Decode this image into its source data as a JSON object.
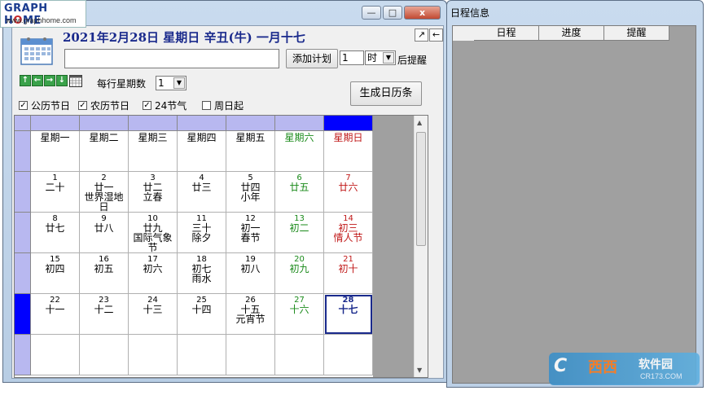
{
  "logo": {
    "brand_a": "GRAPH H",
    "brand_b": "O",
    "brand_c": "ME",
    "url": "www.graphhome.com"
  },
  "window_controls": {
    "minimize": "—",
    "maximize": "□",
    "close": "x"
  },
  "header": {
    "date_line": "2021年2月28日  星期日   辛丑(牛)  一月十七",
    "add_plan_label": "添加计划",
    "quantity_value": "1",
    "unit_value": "时",
    "remind_after": "后提醒",
    "weeks_per_label": "每行星期数",
    "weeks_value": "1",
    "generate_label": "生成日历条",
    "expand_icon": "↗",
    "collapse_icon": "←"
  },
  "nav_icons": [
    "↑",
    "←",
    "→",
    "↓"
  ],
  "checkboxes": [
    {
      "label": "公历节日",
      "checked": true
    },
    {
      "label": "农历节日",
      "checked": true
    },
    {
      "label": "24节气",
      "checked": true
    },
    {
      "label": "周日起",
      "checked": false
    }
  ],
  "calendar": {
    "weekday_headers": [
      "星期一",
      "星期二",
      "星期三",
      "星期四",
      "星期五",
      "星期六",
      "星期日"
    ],
    "weeks": [
      [
        {
          "day": "1",
          "lunar": "二十",
          "festival": ""
        },
        {
          "day": "2",
          "lunar": "廿一",
          "festival": "世界湿地日"
        },
        {
          "day": "3",
          "lunar": "廿二",
          "festival": "立春"
        },
        {
          "day": "4",
          "lunar": "廿三",
          "festival": ""
        },
        {
          "day": "5",
          "lunar": "廿四",
          "festival": "小年"
        },
        {
          "day": "6",
          "lunar": "廿五",
          "festival": ""
        },
        {
          "day": "7",
          "lunar": "廿六",
          "festival": ""
        }
      ],
      [
        {
          "day": "8",
          "lunar": "廿七",
          "festival": ""
        },
        {
          "day": "9",
          "lunar": "廿八",
          "festival": ""
        },
        {
          "day": "10",
          "lunar": "廿九",
          "festival": "国际气象节"
        },
        {
          "day": "11",
          "lunar": "三十",
          "festival": "除夕"
        },
        {
          "day": "12",
          "lunar": "初一",
          "festival": "春节"
        },
        {
          "day": "13",
          "lunar": "初二",
          "festival": ""
        },
        {
          "day": "14",
          "lunar": "初三",
          "festival": "情人节"
        }
      ],
      [
        {
          "day": "15",
          "lunar": "初四",
          "festival": ""
        },
        {
          "day": "16",
          "lunar": "初五",
          "festival": ""
        },
        {
          "day": "17",
          "lunar": "初六",
          "festival": ""
        },
        {
          "day": "18",
          "lunar": "初七",
          "festival": "雨水"
        },
        {
          "day": "19",
          "lunar": "初八",
          "festival": ""
        },
        {
          "day": "20",
          "lunar": "初九",
          "festival": ""
        },
        {
          "day": "21",
          "lunar": "初十",
          "festival": ""
        }
      ],
      [
        {
          "day": "22",
          "lunar": "十一",
          "festival": ""
        },
        {
          "day": "23",
          "lunar": "十二",
          "festival": ""
        },
        {
          "day": "24",
          "lunar": "十三",
          "festival": ""
        },
        {
          "day": "25",
          "lunar": "十四",
          "festival": ""
        },
        {
          "day": "26",
          "lunar": "十五",
          "festival": "元宵节"
        },
        {
          "day": "27",
          "lunar": "十六",
          "festival": ""
        },
        {
          "day": "28",
          "lunar": "十七",
          "festival": "",
          "today": true
        }
      ],
      [
        {
          "day": "",
          "lunar": "",
          "festival": ""
        },
        {
          "day": "",
          "lunar": "",
          "festival": ""
        },
        {
          "day": "",
          "lunar": "",
          "festival": ""
        },
        {
          "day": "",
          "lunar": "",
          "festival": ""
        },
        {
          "day": "",
          "lunar": "",
          "festival": ""
        },
        {
          "day": "",
          "lunar": "",
          "festival": ""
        },
        {
          "day": "",
          "lunar": "",
          "festival": ""
        }
      ]
    ],
    "selected_row": 3,
    "selected_col": 6,
    "colors": {
      "saturday": "#1a8a1a",
      "sunday": "#c01818",
      "header": "#b8b8f0",
      "selected": "#0000ff"
    }
  },
  "schedule": {
    "title": "日程信息",
    "columns": [
      "日程",
      "进度",
      "提醒"
    ]
  },
  "watermark": {
    "c": "C",
    "brand": "西西",
    "name": "软件园",
    "domain": "CR173.COM"
  }
}
